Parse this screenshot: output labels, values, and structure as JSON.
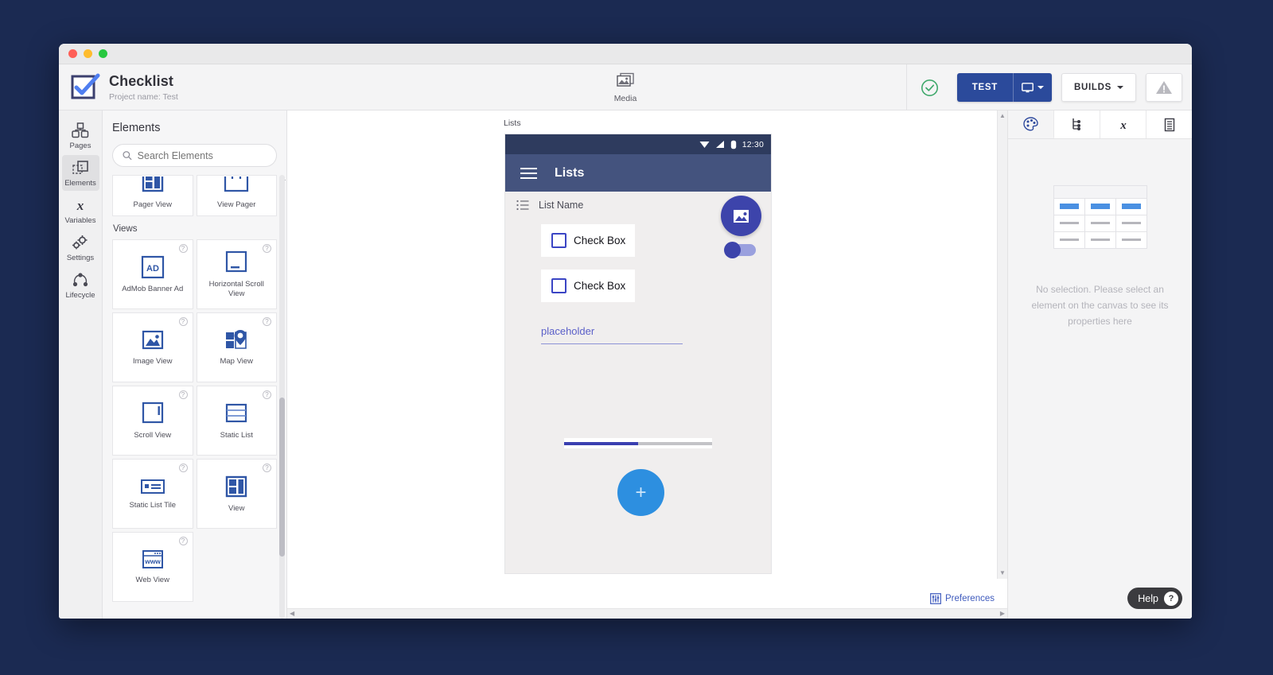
{
  "window": {
    "traffic_lights": [
      "close",
      "minimize",
      "maximize"
    ]
  },
  "header": {
    "app_title": "Checklist",
    "project_label": "Project name: Test",
    "media_label": "Media",
    "status_icon": "check-circle-icon",
    "test_label": "TEST",
    "test_device_icon": "monitor-icon",
    "builds_label": "BUILDS",
    "warning_icon": "warning-triangle-icon",
    "accent_blue": "#2b4a9b",
    "status_green": "#3fa86b"
  },
  "rail": {
    "items": [
      {
        "label": "Pages",
        "icon": "pages-icon",
        "active": false
      },
      {
        "label": "Elements",
        "icon": "elements-icon",
        "active": true
      },
      {
        "label": "Variables",
        "icon": "variables-icon",
        "active": false
      },
      {
        "label": "Settings",
        "icon": "settings-gear-icon",
        "active": false
      },
      {
        "label": "Lifecycle",
        "icon": "lifecycle-icon",
        "active": false
      }
    ]
  },
  "elements_panel": {
    "title": "Elements",
    "search_placeholder": "Search Elements",
    "search_value": "",
    "top_row": [
      {
        "label": "Pager View",
        "icon": "pager-view-icon"
      },
      {
        "label": "View Pager",
        "icon": "view-pager-icon"
      }
    ],
    "group_label": "Views",
    "tiles": [
      {
        "label": "AdMob Banner Ad",
        "icon": "admob-banner-icon",
        "help": "?"
      },
      {
        "label": "Horizontal Scroll View",
        "icon": "horizontal-scroll-view-icon",
        "help": "?"
      },
      {
        "label": "Image View",
        "icon": "image-view-icon",
        "help": "?"
      },
      {
        "label": "Map View",
        "icon": "map-view-icon",
        "help": "?"
      },
      {
        "label": "Scroll View",
        "icon": "scroll-view-icon",
        "help": "?"
      },
      {
        "label": "Static List",
        "icon": "static-list-icon",
        "help": "?"
      },
      {
        "label": "Static List Tile",
        "icon": "static-list-tile-icon",
        "help": "?"
      },
      {
        "label": "View",
        "icon": "view-icon",
        "help": "?"
      },
      {
        "label": "Web View",
        "icon": "web-view-icon",
        "help": "?"
      }
    ]
  },
  "canvas": {
    "page_label": "Lists",
    "preferences_label": "Preferences",
    "preferences_icon": "sliders-icon",
    "phone": {
      "status_time": "12:30",
      "status_icons": [
        "wifi-icon",
        "signal-icon",
        "battery-icon"
      ],
      "appbar_title": "Lists",
      "menu_icon": "hamburger-menu-icon",
      "list_row_label": "List Name",
      "list_row_icon": "list-bullet-icon",
      "list_row_overflow_icon": "overflow-dots-icon",
      "checkboxes": [
        {
          "label": "Check Box",
          "checked": false
        },
        {
          "label": "Check Box",
          "checked": false
        }
      ],
      "image_fab_icon": "image-icon",
      "switch_state": "on",
      "text_field_value": "placeholder",
      "progress_percent": 50,
      "add_fab_label": "+",
      "appbar_color": "#44537e",
      "status_color": "#2e3b5e",
      "primary_color": "#3d44ab",
      "fab_color": "#2d8fe0"
    }
  },
  "props_panel": {
    "tabs": [
      {
        "icon": "palette-icon",
        "name": "style",
        "active": true
      },
      {
        "icon": "tree-icon",
        "name": "tree",
        "active": false
      },
      {
        "icon": "variables-icon",
        "name": "variables",
        "active": false
      },
      {
        "icon": "data-icon",
        "name": "data",
        "active": false
      }
    ],
    "empty_text": "No selection. Please select an element on the canvas to see its properties here",
    "placeholder_icon": "table-placeholder-icon"
  },
  "help": {
    "label": "Help",
    "badge": "?"
  }
}
